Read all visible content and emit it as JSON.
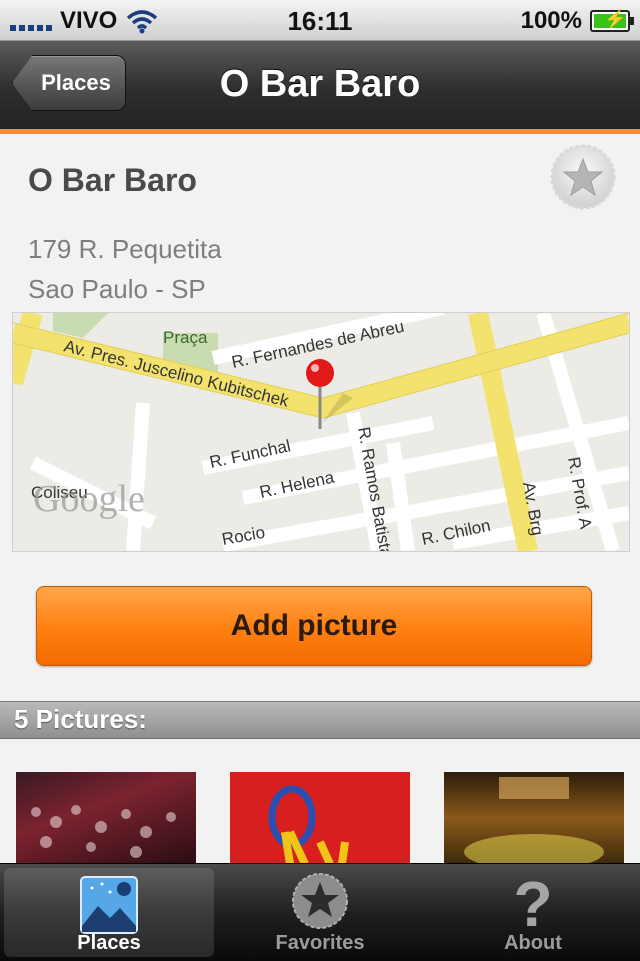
{
  "status_bar": {
    "carrier": "VIVO",
    "time": "16:11",
    "battery": "100%"
  },
  "nav": {
    "back_label": "Places",
    "title": "O Bar Baro"
  },
  "place": {
    "name": "O Bar Baro",
    "address_line1": "179 R. Pequetita",
    "address_line2": "Sao Paulo - SP"
  },
  "map": {
    "streets": [
      "R. Fernandes de Abreu",
      "Av. Pres. Juscelino Kubitschek",
      "R. Funchal",
      "R. Helena",
      "R. Ramos Batista",
      "R. Chilon",
      "Av. Brg",
      "R. Prof. A",
      "Rocio",
      "Coliseu",
      "Praça"
    ],
    "watermark": "Google"
  },
  "actions": {
    "add_picture": "Add picture"
  },
  "pictures": {
    "header": "5 Pictures:"
  },
  "tabs": [
    {
      "label": "Places",
      "icon": "places-icon",
      "active": true
    },
    {
      "label": "Favorites",
      "icon": "star-icon",
      "active": false
    },
    {
      "label": "About",
      "icon": "question-icon",
      "active": false
    }
  ]
}
